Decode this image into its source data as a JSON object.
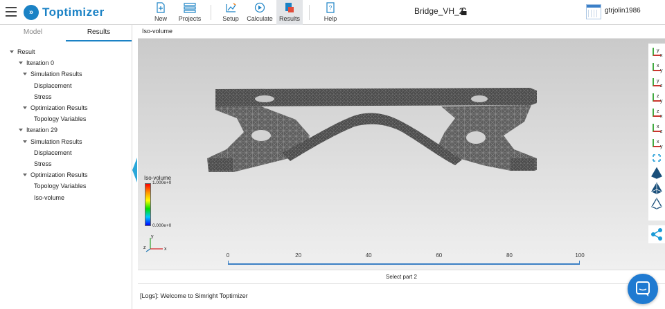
{
  "header": {
    "logo_text": "Toptimizer",
    "doc_title": "Bridge_VH_2",
    "username": "gtrjolin1986",
    "tools": [
      {
        "label": "New",
        "icon": "new-file-icon"
      },
      {
        "label": "Projects",
        "icon": "projects-list-icon"
      },
      {
        "label": "Setup",
        "icon": "setup-icon"
      },
      {
        "label": "Calculate",
        "icon": "calculate-icon"
      },
      {
        "label": "Results",
        "icon": "results-icon"
      },
      {
        "label": "Help",
        "icon": "help-icon"
      }
    ],
    "active_tool": "Results"
  },
  "left_panel": {
    "tabs": [
      "Model",
      "Results"
    ],
    "active_tab": "Results",
    "tree": [
      {
        "label": "Result",
        "level": 0,
        "expanded": true
      },
      {
        "label": "Iteration 0",
        "level": 1,
        "expanded": true
      },
      {
        "label": "Simulation Results",
        "level": 2,
        "expanded": true
      },
      {
        "label": "Displacement",
        "level": 3
      },
      {
        "label": "Stress",
        "level": 3
      },
      {
        "label": "Optimization Results",
        "level": 2,
        "expanded": true
      },
      {
        "label": "Topology Variables",
        "level": 3
      },
      {
        "label": "Iteration 29",
        "level": 1,
        "expanded": true
      },
      {
        "label": "Simulation Results",
        "level": 2,
        "expanded": true
      },
      {
        "label": "Displacement",
        "level": 3
      },
      {
        "label": "Stress",
        "level": 3
      },
      {
        "label": "Optimization Results",
        "level": 2,
        "expanded": true
      },
      {
        "label": "Topology Variables",
        "level": 3
      },
      {
        "label": "Iso-volume",
        "level": 3
      }
    ]
  },
  "viewer": {
    "title": "Iso-volume",
    "legend": {
      "title": "Iso-volume",
      "max": "1.000e+0",
      "min": "0.000e+0"
    },
    "scale": {
      "labels": [
        "0",
        "20",
        "40",
        "60",
        "80",
        "100"
      ]
    },
    "triad": {
      "x": "x",
      "y": "y",
      "z": "z"
    },
    "view_buttons": [
      "view-front-icon",
      "view-back-icon",
      "view-left-icon",
      "view-right-icon",
      "view-top-icon",
      "view-bottom-icon",
      "view-iso-icon",
      "fit-view-icon",
      "shaded-icon",
      "shaded-edges-icon",
      "wireframe-icon"
    ],
    "mesh_color": "#555555"
  },
  "status": {
    "text": "Select part 2"
  },
  "logs": {
    "text": "[Logs]: Welcome to Simright Toptimizer"
  },
  "colors": {
    "accent": "#1b82c5",
    "handle": "#2aa7d9"
  }
}
